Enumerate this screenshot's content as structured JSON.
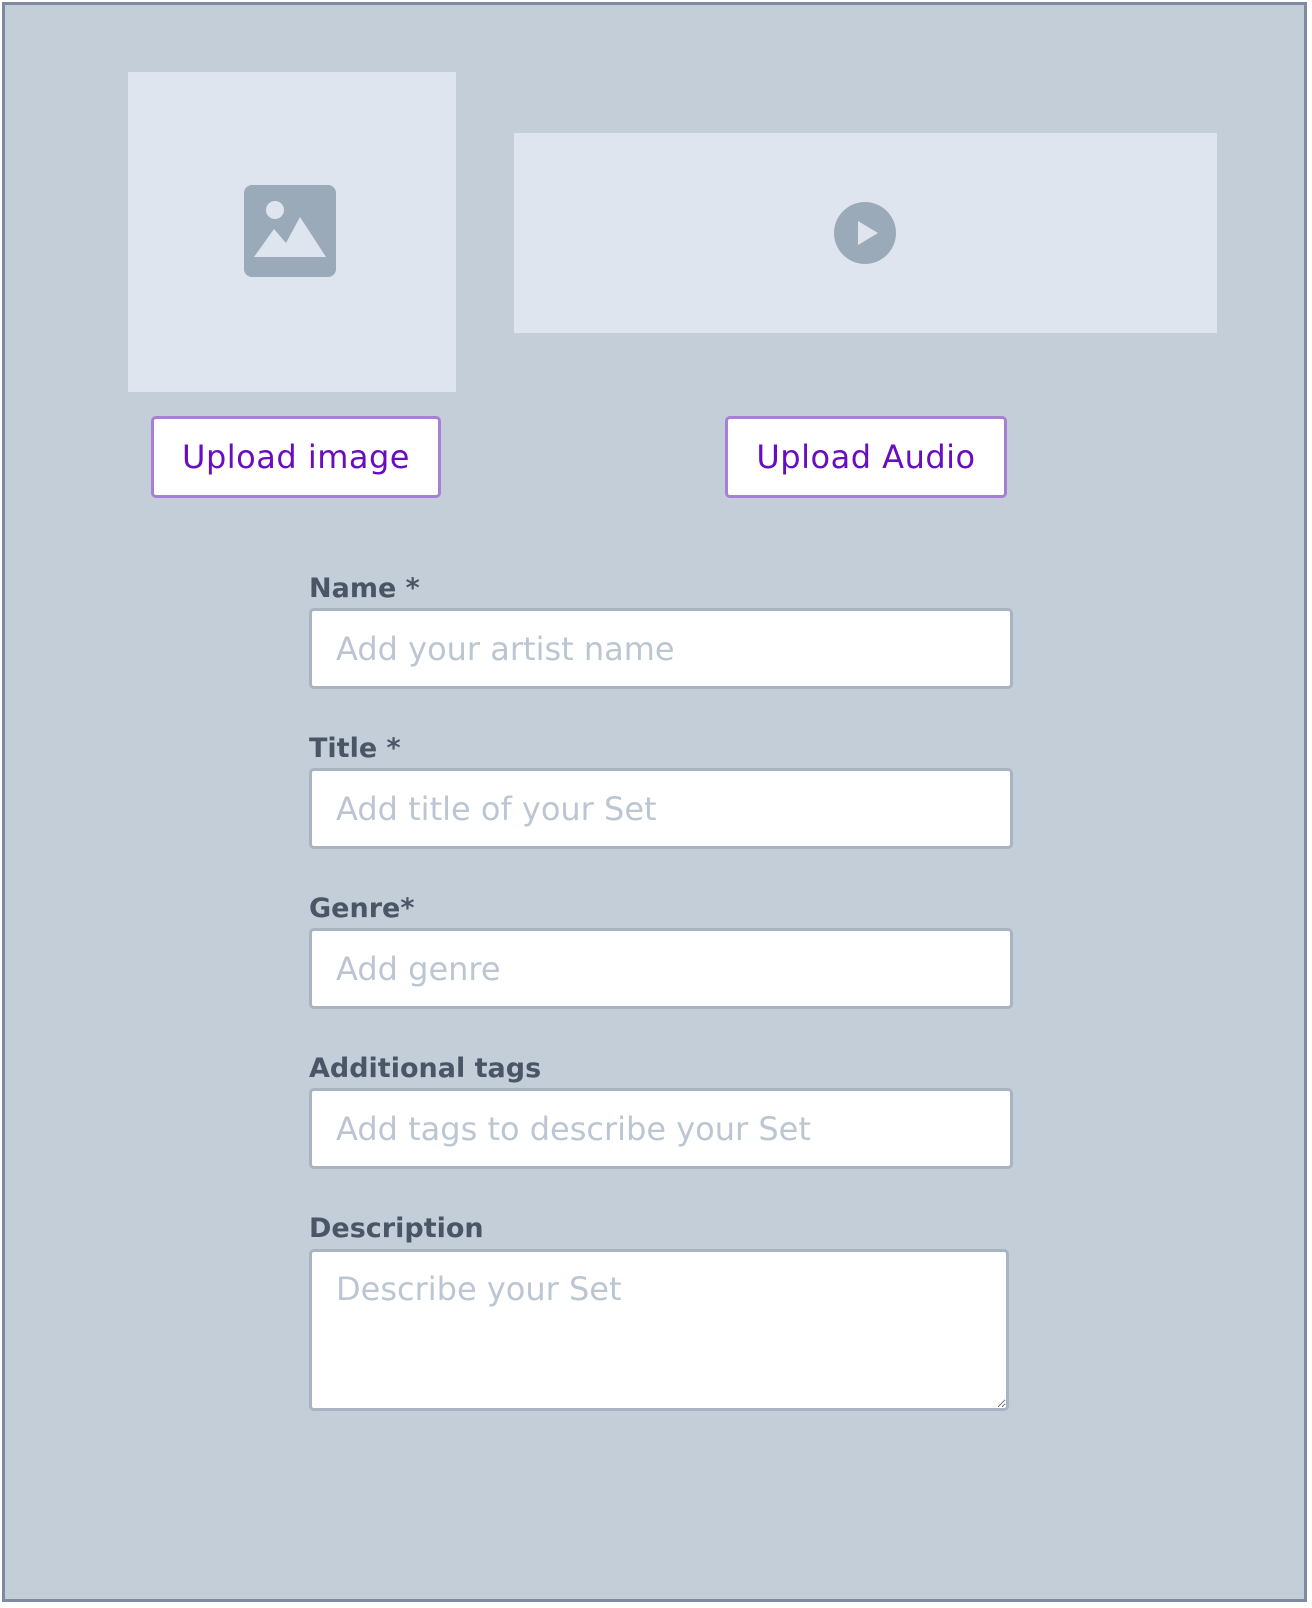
{
  "media": {
    "image_placeholder_icon": "image-icon",
    "audio_placeholder_icon": "play-icon",
    "upload_image_label": "Upload image",
    "upload_audio_label": "Upload Audio"
  },
  "form": {
    "name": {
      "label": "Name *",
      "placeholder": "Add your artist name",
      "value": ""
    },
    "title": {
      "label": "Title *",
      "placeholder": "Add title of your Set",
      "value": ""
    },
    "genre": {
      "label": "Genre*",
      "placeholder": "Add genre",
      "value": ""
    },
    "tags": {
      "label": "Additional tags",
      "placeholder": "Add tags to describe your Set",
      "value": ""
    },
    "description": {
      "label": "Description",
      "placeholder": "Describe your Set",
      "value": ""
    }
  },
  "colors": {
    "background": "#c3ced9",
    "placeholder_box": "#dfe5ee",
    "icon": "#9aaab8",
    "accent": "#6a0dc0",
    "button_border": "#a77fd4",
    "label": "#4a5666",
    "placeholder_text": "#bcc6d2"
  }
}
